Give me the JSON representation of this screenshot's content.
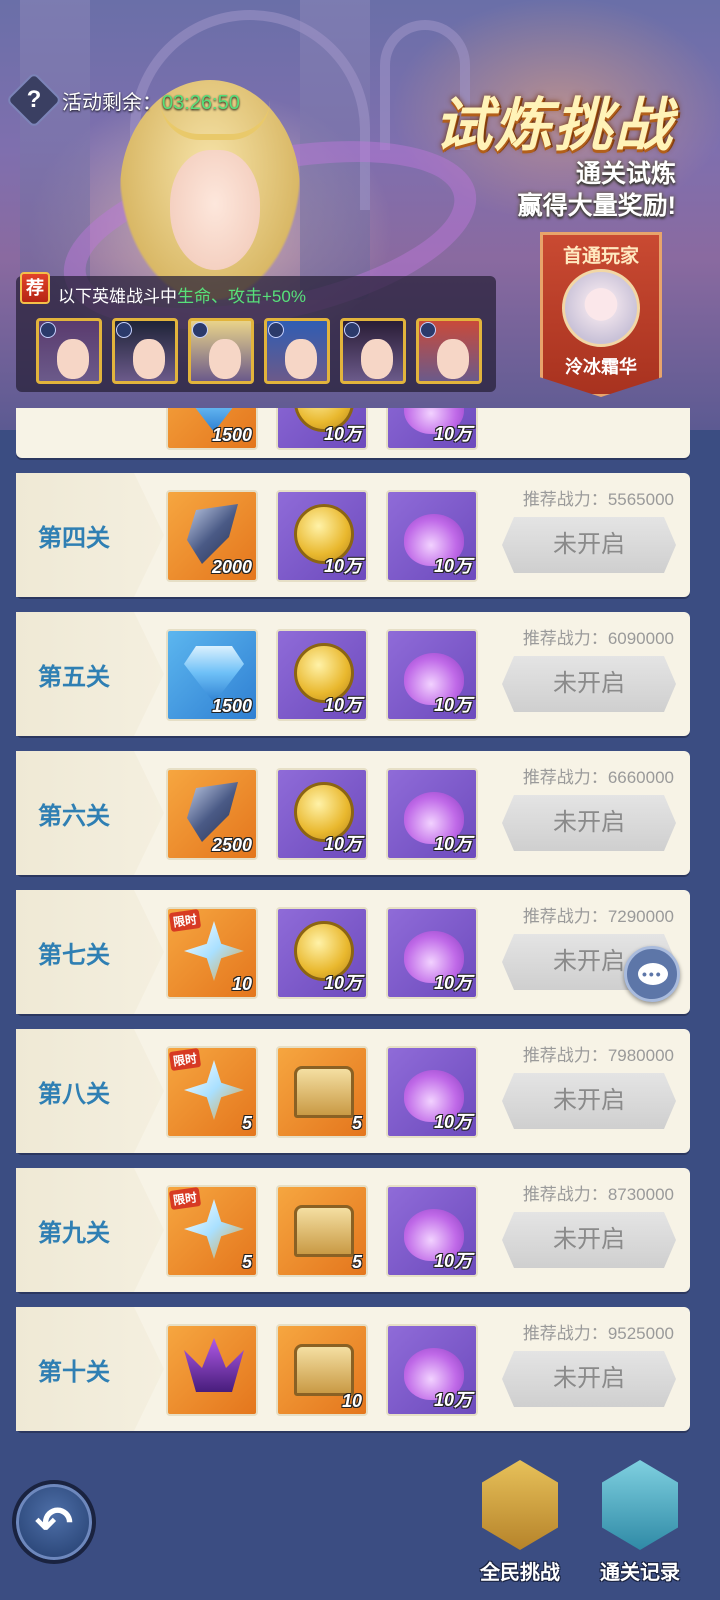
{
  "header": {
    "help_icon": "question-icon",
    "help_glyph": "?",
    "timer_label": "活动剩余：",
    "timer_value": "03:26:50",
    "title": "试炼挑战",
    "subtitle_line1": "通关试炼",
    "subtitle_line2": "赢得大量奖励!"
  },
  "first_clear": {
    "title": "首通玩家",
    "player_name": "泠冰霜华"
  },
  "bonus": {
    "badge": "荐",
    "text_prefix": "以下英雄战斗中",
    "text_highlight": "生命、攻击+50%",
    "heroes": [
      {
        "element_icon": "water-element-icon",
        "hair": "#5a3b6e"
      },
      {
        "element_icon": "sun-element-icon",
        "hair": "#1f2438"
      },
      {
        "element_icon": "sun-element-icon",
        "hair": "#e9d38a"
      },
      {
        "element_icon": "shadow-element-icon",
        "hair": "#2f5db3"
      },
      {
        "element_icon": "shadow-element-icon",
        "hair": "#2a1d36"
      },
      {
        "element_icon": "shadow-element-icon",
        "hair": "#c94a3a"
      }
    ]
  },
  "partial_row": {
    "items": [
      {
        "icon": "diamond-icon",
        "qty": "1500",
        "bg": "orange"
      },
      {
        "icon": "gold-coin-icon",
        "qty": "10万",
        "bg": "purple"
      },
      {
        "icon": "potion-icon",
        "qty": "10万",
        "bg": "purple"
      }
    ]
  },
  "stages": [
    {
      "name": "第四关",
      "power_label": "推荐战力：",
      "power": "5565000",
      "status": "未开启",
      "items": [
        {
          "icon": "dark-crystal-icon",
          "qty": "2000",
          "bg": "orange"
        },
        {
          "icon": "gold-coin-icon",
          "qty": "10万",
          "bg": "purple"
        },
        {
          "icon": "potion-icon",
          "qty": "10万",
          "bg": "purple"
        }
      ]
    },
    {
      "name": "第五关",
      "power_label": "推荐战力：",
      "power": "6090000",
      "status": "未开启",
      "items": [
        {
          "icon": "diamond-icon",
          "qty": "1500",
          "bg": "blue"
        },
        {
          "icon": "gold-coin-icon",
          "qty": "10万",
          "bg": "purple"
        },
        {
          "icon": "potion-icon",
          "qty": "10万",
          "bg": "purple"
        }
      ]
    },
    {
      "name": "第六关",
      "power_label": "推荐战力：",
      "power": "6660000",
      "status": "未开启",
      "items": [
        {
          "icon": "dark-crystal-icon",
          "qty": "2500",
          "bg": "orange"
        },
        {
          "icon": "gold-coin-icon",
          "qty": "10万",
          "bg": "purple"
        },
        {
          "icon": "potion-icon",
          "qty": "10万",
          "bg": "purple"
        }
      ]
    },
    {
      "name": "第七关",
      "power_label": "推荐战力：",
      "power": "7290000",
      "status": "未开启",
      "items": [
        {
          "icon": "star-shard-icon",
          "qty": "10",
          "bg": "orange",
          "tag": "限时"
        },
        {
          "icon": "gold-coin-icon",
          "qty": "10万",
          "bg": "purple"
        },
        {
          "icon": "potion-icon",
          "qty": "10万",
          "bg": "purple"
        }
      ]
    },
    {
      "name": "第八关",
      "power_label": "推荐战力：",
      "power": "7980000",
      "status": "未开启",
      "items": [
        {
          "icon": "star-shard-icon",
          "qty": "5",
          "bg": "orange",
          "tag": "限时"
        },
        {
          "icon": "treasure-chest-icon",
          "qty": "5",
          "bg": "orange"
        },
        {
          "icon": "potion-icon",
          "qty": "10万",
          "bg": "purple"
        }
      ]
    },
    {
      "name": "第九关",
      "power_label": "推荐战力：",
      "power": "8730000",
      "status": "未开启",
      "items": [
        {
          "icon": "star-shard-icon",
          "qty": "5",
          "bg": "orange",
          "tag": "限时"
        },
        {
          "icon": "treasure-chest-icon",
          "qty": "5",
          "bg": "orange"
        },
        {
          "icon": "potion-icon",
          "qty": "10万",
          "bg": "purple"
        }
      ]
    },
    {
      "name": "第十关",
      "power_label": "推荐战力：",
      "power": "9525000",
      "status": "未开启",
      "items": [
        {
          "icon": "dark-wings-icon",
          "qty": "",
          "bg": "orange"
        },
        {
          "icon": "treasure-chest-icon",
          "qty": "10",
          "bg": "orange"
        },
        {
          "icon": "potion-icon",
          "qty": "10万",
          "bg": "purple"
        }
      ]
    }
  ],
  "bottom": {
    "back_icon": "back-arrow-icon",
    "back_glyph": "↶",
    "all_challenge_label": "全民挑战",
    "clear_record_label": "通关记录"
  }
}
